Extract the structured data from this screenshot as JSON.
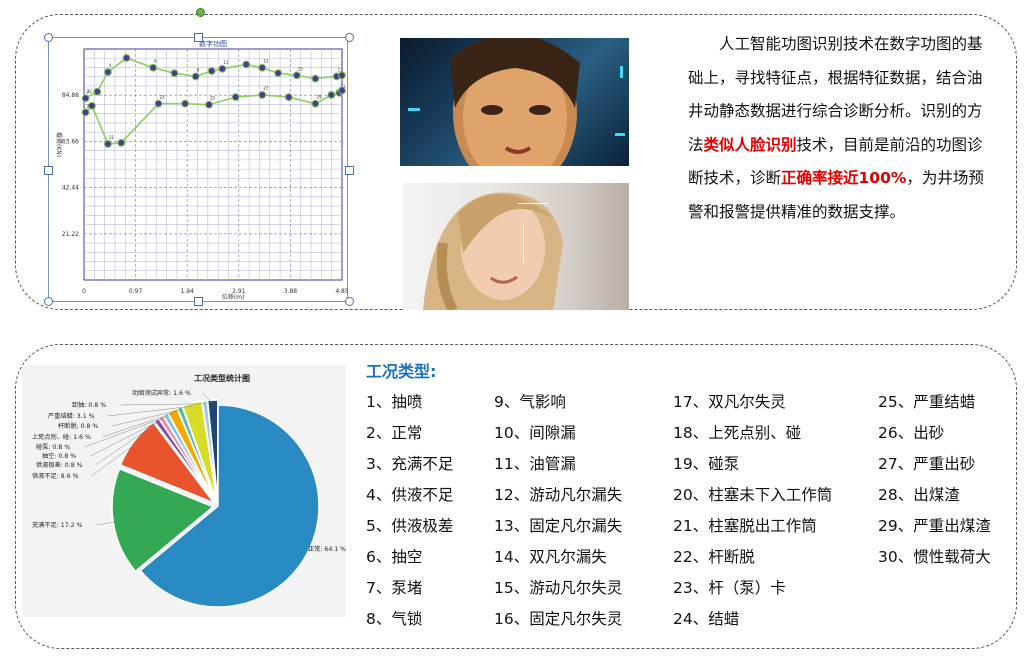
{
  "dynamometer": {
    "title": "数字功图",
    "y_label": "载荷(KN)",
    "x_label": "位移(m)",
    "y_ticks": [
      "84.88",
      "63.66",
      "42.44",
      "21.22"
    ],
    "x_ticks": [
      "0",
      "0.97",
      "1.94",
      "2.91",
      "3.88",
      "4.85"
    ],
    "point_labels": [
      "2",
      "4",
      "6",
      "9",
      "11",
      "13",
      "15",
      "17",
      "20",
      "21",
      "23",
      "25",
      "27",
      "29",
      "31",
      "33"
    ],
    "upper_curve": [
      [
        0.03,
        83.5
      ],
      [
        0.25,
        86.5
      ],
      [
        0.45,
        95.5
      ],
      [
        0.8,
        102
      ],
      [
        1.3,
        97.5
      ],
      [
        1.7,
        95
      ],
      [
        2.1,
        93.5
      ],
      [
        2.4,
        96
      ],
      [
        2.6,
        97
      ],
      [
        3.05,
        99
      ],
      [
        3.35,
        97.5
      ],
      [
        3.65,
        95
      ],
      [
        4.0,
        94
      ],
      [
        4.35,
        92.5
      ],
      [
        4.75,
        93.5
      ],
      [
        4.85,
        94
      ]
    ],
    "lower_curve": [
      [
        0.03,
        77
      ],
      [
        0.15,
        80
      ],
      [
        0.45,
        62.5
      ],
      [
        0.7,
        63
      ],
      [
        1.4,
        81
      ],
      [
        1.9,
        81
      ],
      [
        2.35,
        80.5
      ],
      [
        2.85,
        84
      ],
      [
        3.35,
        85
      ],
      [
        3.85,
        84
      ],
      [
        4.35,
        81
      ],
      [
        4.65,
        85
      ],
      [
        4.8,
        86
      ],
      [
        4.85,
        87
      ]
    ]
  },
  "photos": {
    "face_photo": "face-recognition-photo",
    "woman_photo": "woman-face-scan-photo"
  },
  "description": {
    "seg1": "人工智能功图识别技术在数字功图的基础上，寻找特征点，根据特征数据，结合油井动静态数据进行综合诊断分析。识别的方法",
    "seg2_red": "类似人脸识别",
    "seg3": "技术，目前是前沿的功图诊断技术，诊断",
    "seg4_red": "正确率接近100%",
    "seg5": "，为井场预警和报警提供精准的数据支撑。"
  },
  "chart_data": {
    "type": "pie",
    "title": "工况类型统计图",
    "categories": [
      "正常",
      "充满不足",
      "供液不足",
      "供液极差",
      "抽空",
      "碰泵",
      "上死点别、碰",
      "杆断脱",
      "严重结蜡",
      "卸抽",
      "功图测试异常"
    ],
    "values": [
      64.1,
      17.2,
      8.6,
      0.8,
      0.8,
      0.8,
      1.6,
      0.8,
      3.1,
      0.8,
      1.6
    ],
    "labels": [
      "正常: 64.1 %",
      "充满不足: 17.2 %",
      "供液不足: 8.6 %",
      "供液极差: 0.8 %",
      "抽空: 0.8 %",
      "碰泵: 0.8 %",
      "上死点别、碰: 1.6 %",
      "杆断脱: 0.8 %",
      "严重结蜡: 3.1 %",
      "卸抽: 0.8 %",
      "功图测试异常: 1.6 %"
    ],
    "colors": [
      "#2a8ac4",
      "#34a853",
      "#e8542b",
      "#7b4ea3",
      "#e78fb5",
      "#7fc6e0",
      "#f2a900",
      "#4ebfa0",
      "#d7dc27",
      "#9ecae1",
      "#21456e"
    ]
  },
  "conditions": {
    "title": "工况类型:",
    "columns": [
      [
        "1、抽喷",
        "2、正常",
        "3、充满不足",
        "4、供液不足",
        "5、供液极差",
        "6、抽空",
        "7、泵堵",
        "8、气锁"
      ],
      [
        "9、气影响",
        "10、间隙漏",
        "11、油管漏",
        "12、游动凡尔漏失",
        "13、固定凡尔漏失",
        "14、双凡尔漏失",
        "15、游动凡尔失灵",
        "16、固定凡尔失灵"
      ],
      [
        "17、双凡尔失灵",
        "18、上死点别、碰",
        "19、碰泵",
        "20、柱塞未下入工作筒",
        "21、柱塞脱出工作筒",
        "22、杆断脱",
        "23、杆（泵）卡",
        "24、结蜡"
      ],
      [
        "25、严重结蜡",
        "26、出砂",
        "27、严重出砂",
        "28、出煤渣",
        "29、严重出煤渣",
        "30、惯性载荷大"
      ]
    ]
  }
}
